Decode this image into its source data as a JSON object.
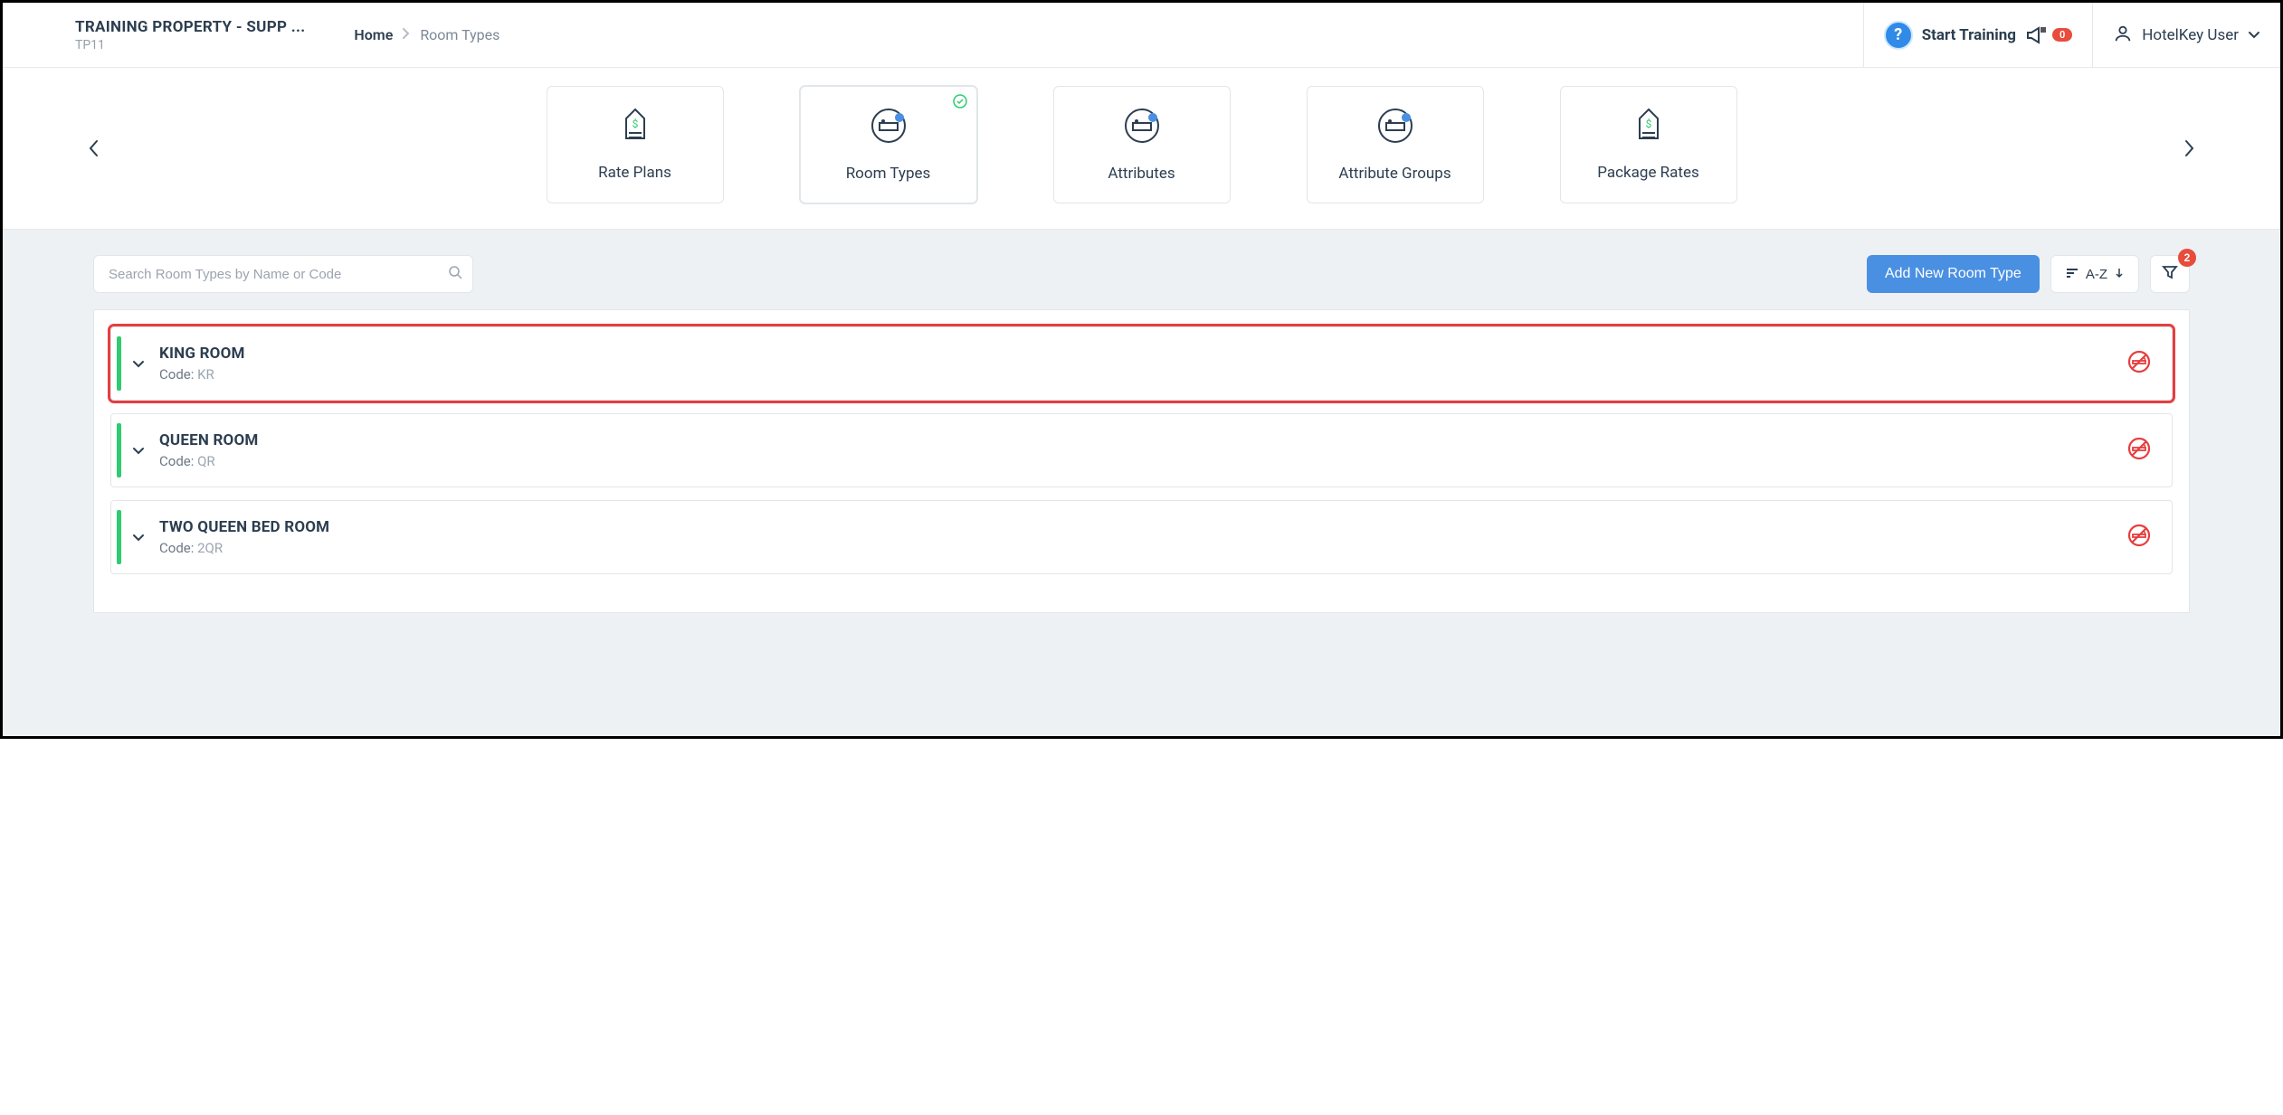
{
  "header": {
    "property_name": "TRAINING PROPERTY - SUPP ...",
    "property_code": "TP11",
    "breadcrumb_home": "Home",
    "breadcrumb_current": "Room Types",
    "start_training": "Start Training",
    "notif_count": "0",
    "user_name": "HotelKey User"
  },
  "categories": {
    "items": [
      {
        "label": "Rate Plans"
      },
      {
        "label": "Room Types"
      },
      {
        "label": "Attributes"
      },
      {
        "label": "Attribute Groups"
      },
      {
        "label": "Package Rates"
      }
    ]
  },
  "toolbar": {
    "search_placeholder": "Search Room Types by Name or Code",
    "add_button": "Add New Room Type",
    "sort_label": "A-Z",
    "filter_count": "2"
  },
  "rooms": {
    "code_label": "Code: ",
    "items": [
      {
        "name": "KING ROOM",
        "code": "KR"
      },
      {
        "name": "QUEEN ROOM",
        "code": "QR"
      },
      {
        "name": "TWO QUEEN BED ROOM",
        "code": "2QR"
      }
    ]
  }
}
